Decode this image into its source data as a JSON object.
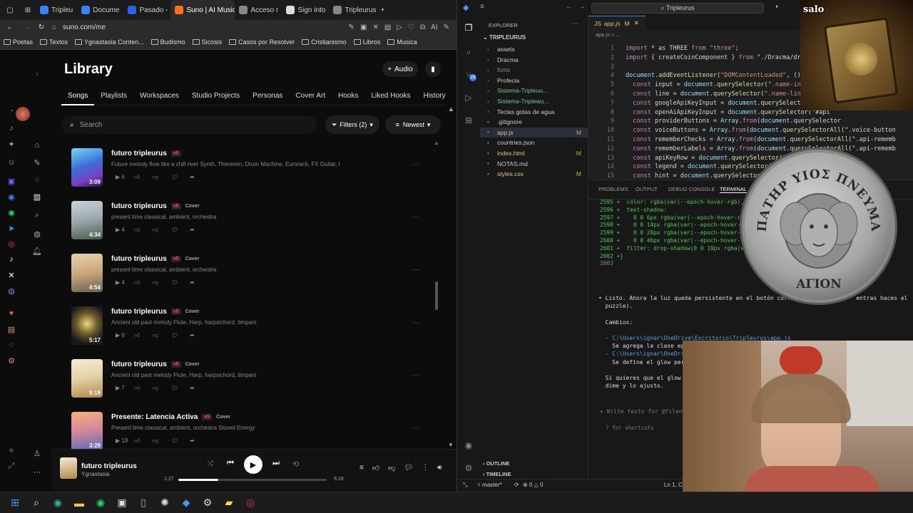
{
  "browser": {
    "tabs": [
      {
        "label": "Tripleu",
        "color": "#3b82f6"
      },
      {
        "label": "Docume",
        "color": "#3b82f6"
      },
      {
        "label": "Pasado -",
        "color": "#2563eb"
      },
      {
        "label": "Suno | AI Music",
        "color": "#f97316"
      },
      {
        "label": "Acceso r",
        "color": "#888888"
      },
      {
        "label": "Sign into",
        "color": "#dddddd"
      },
      {
        "label": "Tripleurus",
        "color": "#888888"
      }
    ],
    "url": "suno.com/me",
    "bookmarks": [
      "Poetas",
      "Textos",
      "Ygnastasia Conten...",
      "Budismo",
      "Sicosis",
      "Casos por Resolver",
      "Cristianismo",
      "Libros",
      "Musica"
    ]
  },
  "library": {
    "title": "Library",
    "audio_label": "Audio",
    "tabs": [
      "Songs",
      "Playlists",
      "Workspaces",
      "Studio Projects",
      "Personas",
      "Cover Art",
      "Hooks",
      "Liked Hooks",
      "History"
    ],
    "search_placeholder": "Search",
    "filters_label": "Filters (2)",
    "sort_label": "Newest",
    "songs": [
      {
        "title": "futuro tripleurus",
        "version": "v5",
        "cover": "",
        "desc": "Future melody flow like a chill river Synth, Theremin, Drum Machine, Eurorack, FX Guitar, Pro...",
        "duration": "3:09",
        "plays": "6",
        "thumb": "linear-gradient(160deg,#7ad7f0,#3b6fd8 45%,#7a3fc0 75%,#1a1a4a)"
      },
      {
        "title": "futuro tripleurus",
        "version": "v5",
        "cover": "Cover",
        "desc": "present time classical, ambient, orchestra",
        "duration": "4:34",
        "plays": "4",
        "thumb": "linear-gradient(170deg,#c9d2d6,#9aa8ad 50%,#4a5a4a)"
      },
      {
        "title": "futuro tripleurus",
        "version": "v5",
        "cover": "Cover",
        "desc": "present time classical, ambient, orchestra",
        "duration": "4:54",
        "plays": "4",
        "thumb": "linear-gradient(170deg,#e9d3b0,#c9a77a 50%,#6a6050)"
      },
      {
        "title": "futuro tripleurus",
        "version": "v5",
        "cover": "Cover",
        "desc": "Ancient old past melody Flute, Harp, harpsichord, timpani",
        "duration": "5:17",
        "plays": "6",
        "thumb": "radial-gradient(circle at 50% 45%,#f0d27a,#6a5a2a 40%,#1a1a1a 75%)"
      },
      {
        "title": "futuro tripleurus",
        "version": "v5",
        "cover": "Cover",
        "desc": "Ancient old past melody Flute, Harp, harpsichord, timpani",
        "duration": "5:19",
        "plays": "7",
        "thumb": "linear-gradient(170deg,#f5ecd8,#e2cfa4 50%,#b08a4a)"
      },
      {
        "title": "Presente: Latencia Activa",
        "version": "v5",
        "cover": "Cover",
        "desc": "Present time classical, ambient, orchestra Stored Energy",
        "duration": "3:29",
        "plays": "18",
        "thumb": "linear-gradient(170deg,#f5b07a,#d98a9a 45%,#5a6ab8)"
      }
    ]
  },
  "player": {
    "title": "futuro tripleurus",
    "artist": "Ygnastasia",
    "elapsed": "1:27",
    "total": "5:19",
    "progress": 0.27
  },
  "vscode": {
    "search": "Tripleurus",
    "explorer_title": "EXPLORER",
    "root": "TRIPLEURUS",
    "files": [
      {
        "name": "assets",
        "type": "folder",
        "mod": "",
        "color": "#cccccc"
      },
      {
        "name": "Dracma",
        "type": "folder",
        "mod": "",
        "color": "#cccccc"
      },
      {
        "name": "fonts",
        "type": "folder",
        "mod": "",
        "color": "#888888"
      },
      {
        "name": "Profecia",
        "type": "folder",
        "mod": "",
        "color": "#cccccc"
      },
      {
        "name": "Sistema-Tripleuu...",
        "type": "folder",
        "mod": "",
        "color": "#73c991"
      },
      {
        "name": "Sistema-Triplewu...",
        "type": "folder",
        "mod": "",
        "color": "#73c991"
      },
      {
        "name": "Teclas gotas de agua",
        "type": "folder",
        "mod": "",
        "color": "#cccccc"
      },
      {
        "name": ".gitignore",
        "type": "file",
        "mod": "",
        "color": "#cccccc"
      },
      {
        "name": "app.js",
        "type": "file",
        "mod": "M",
        "color": "#e2c08d"
      },
      {
        "name": "countries.json",
        "type": "file",
        "mod": "",
        "color": "#cccccc"
      },
      {
        "name": "index.html",
        "type": "file",
        "mod": "M",
        "color": "#e2c08d"
      },
      {
        "name": "NOTAS.md",
        "type": "file",
        "mod": "",
        "color": "#cccccc"
      },
      {
        "name": "styles.css",
        "type": "file",
        "mod": "M",
        "color": "#e2c08d"
      }
    ],
    "editor_tab": "app.js",
    "editor_tab_mod": "M",
    "breadcrumb": "app.js > ...",
    "code": [
      {
        "n": "1",
        "t": "import * as THREE from \"three\";"
      },
      {
        "n": "2",
        "t": "import { createCoinComponent } from \"./Dracma/dracma-tri"
      },
      {
        "n": "3",
        "t": ""
      },
      {
        "n": "4",
        "t": "document.addEventListener(\"DOMContentLoaded\", () => {"
      },
      {
        "n": "5",
        "t": "  const input = document.querySelector(\".name-input\");"
      },
      {
        "n": "6",
        "t": "  const line = document.querySelector(\".name-line\");"
      },
      {
        "n": "7",
        "t": "  const googleApiKeyInput = document.querySelector(\"#api"
      },
      {
        "n": "8",
        "t": "  const openAiApiKeyInput = document.querySelector(\"#api"
      },
      {
        "n": "9",
        "t": "  const providerButtons = Array.from(document.querySelector"
      },
      {
        "n": "10",
        "t": "  const voiceButtons = Array.from(document.querySelectorAll(\".voice-button"
      },
      {
        "n": "11",
        "t": "  const rememberChecks = Array.from(document.querySelectorAll(\".api-rememb"
      },
      {
        "n": "12",
        "t": "  const rememberLabels = Array.from(document.querySelectorAll(\".api-rememb"
      },
      {
        "n": "13",
        "t": "  const apiKeyRow = document.querySelector(\".api-"
      },
      {
        "n": "14",
        "t": "  const legend = document.querySelector(\".time"
      },
      {
        "n": "15",
        "t": "  const hint = document.querySelector(\".name"
      }
    ],
    "panel_tabs": [
      "PROBLEMS",
      "OUTPUT",
      "DEBUG CONSOLE",
      "TERMINAL",
      "PORTS"
    ],
    "terminal": [
      "2595 +  color: rgba(var(--epoch-hover-rgb), 0.8",
      "2596 +  text-shadow:",
      "2597 +    0 0 6px rgba(var(--epoch-hover-rgb),",
      "2598 +    0 0 14px rgba(var(--epoch-hover-rgb)",
      "2599 +    0 0 28px rgba(var(--epoch-hover-rgb)",
      "2600 +    0 0 46px rgba(var(--epoch-hover-rgb)",
      "2601 +  filter: drop-shadow(0 0 10px rgba(var(--",
      "2602 +}",
      "2603"
    ],
    "chat": [
      "• Listo. Ahora la luz queda persistente en el botón correcto al p          entras haces el",
      "  puzzle).",
      "",
      "  Cambios:",
      "",
      "  - C:\\Users\\ignar\\OneDrive\\Escritorio\\Tripleurus\\app.js",
      "    Se agrega la clase epoch-glow",
      "  - C:\\Users\\ignar\\OneDrive\\Escrit",
      "    Se define el glow persistente",
      "",
      "  Si quieres que el glow persista",
      "  dime y lo ajusto."
    ],
    "prompt_placeholder": "Write tests for @filename",
    "shortcuts": "? for shortcuts",
    "outline": "OUTLINE",
    "timeline": "TIMELINE",
    "branch": "master*",
    "errors": "0",
    "warnings": "0",
    "cursor": "Ln 1, Co"
  },
  "coin": {
    "legend": "ΠΑΤΗΡ ΥΙΟΣ ΠΝΕΥΜΑ",
    "bottom": "ΑΓΙΟΝ"
  },
  "book": {
    "label": "salo"
  }
}
